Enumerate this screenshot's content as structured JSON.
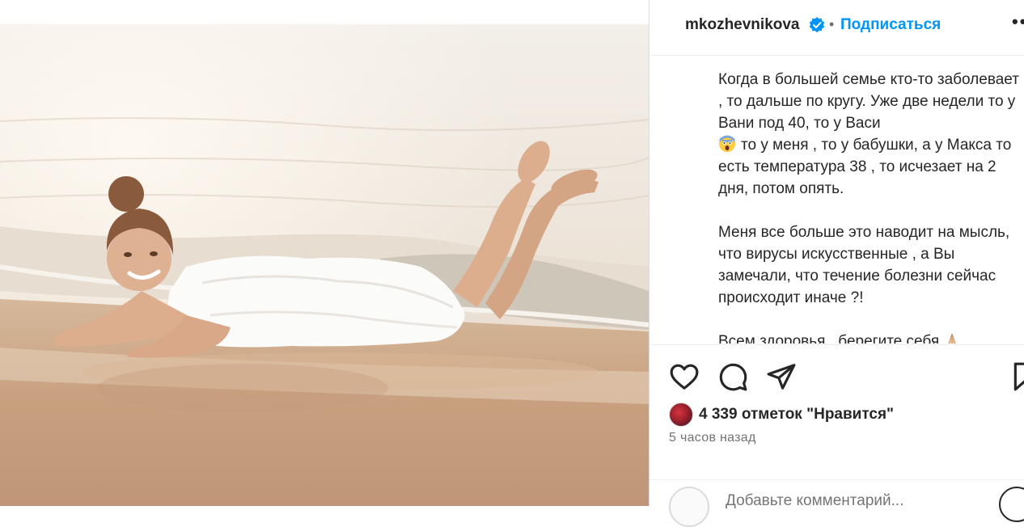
{
  "post": {
    "username": "mkozhevnikova",
    "verified": true,
    "separator": "•",
    "follow_label": "Подписаться",
    "more_label": "••",
    "caption": {
      "p1_before_emoji": "Когда в большей семье кто-то заболевает , то дальше по кругу. Уже две недели то у Вани под 40, то у Васи",
      "p1_emoji": "screaming-face-emoji",
      "p1_after_emoji": "то у меня , то у бабушки, а у Макса то есть температура 38 , то исчезает на 2 дня, потом опять.",
      "p2": "Меня все больше это наводит на мысль, что вирусы искусственные , а Вы замечали, что течение болезни сейчас происходит иначе ?!",
      "p3": "Всем здоровья , берегите себя",
      "p3_emoji": "folded-hands-emoji"
    },
    "likes_text": "4 339 отметок \"Нравится\"",
    "time_ago": "5 часов назад",
    "comment_placeholder": "Добавьте комментарий..."
  },
  "icons": {
    "like": "heart-icon",
    "comment": "comment-icon",
    "share": "paper-plane-icon",
    "save": "bookmark-icon",
    "emoji": "smiley-icon"
  },
  "colors": {
    "accent": "#0095f6",
    "text": "#262626",
    "secondary": "#737373",
    "border": "#dbdbdb"
  }
}
